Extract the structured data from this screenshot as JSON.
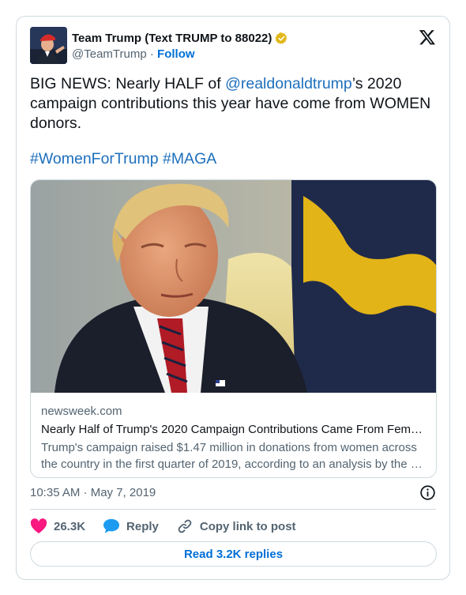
{
  "author": {
    "display_name": "Team Trump (Text TRUMP to 88022)",
    "handle": "@TeamTrump",
    "separator": "·",
    "follow_label": "Follow",
    "verified_badge_color": "#e2b719"
  },
  "tweet": {
    "text_before_mention": "BIG NEWS: Nearly HALF of ",
    "mention": "@realdonaldtrump",
    "text_after_mention": "’s 2020 campaign contributions this year have come from WOMEN donors.",
    "hashtags": [
      "#WomenForTrump",
      "#MAGA"
    ]
  },
  "link_card": {
    "domain": "newsweek.com",
    "title": "Nearly Half of Trump's 2020 Campaign Contributions Came From Fem…",
    "description": "Trump's campaign raised $1.47 million in donations from women across the country in the first quarter of 2019, according to an analysis by the …"
  },
  "timestamp": "10:35 AM · May 7, 2019",
  "actions": {
    "like_count": "26.3K",
    "reply_label": "Reply",
    "copy_label": "Copy link to post"
  },
  "read_replies_label": "Read 3.2K replies",
  "colors": {
    "link_blue": "#1d6fbd",
    "follow_blue": "#006fd6",
    "like_pink": "#f91880",
    "reply_blue": "#1d9bf0",
    "muted_gray": "#536471",
    "border": "#cfd9de"
  },
  "icons": {
    "brand": "x-logo-icon",
    "verified": "verified-badge-icon",
    "info": "info-icon",
    "like": "heart-icon",
    "reply": "speech-bubble-icon",
    "copy": "link-icon"
  }
}
